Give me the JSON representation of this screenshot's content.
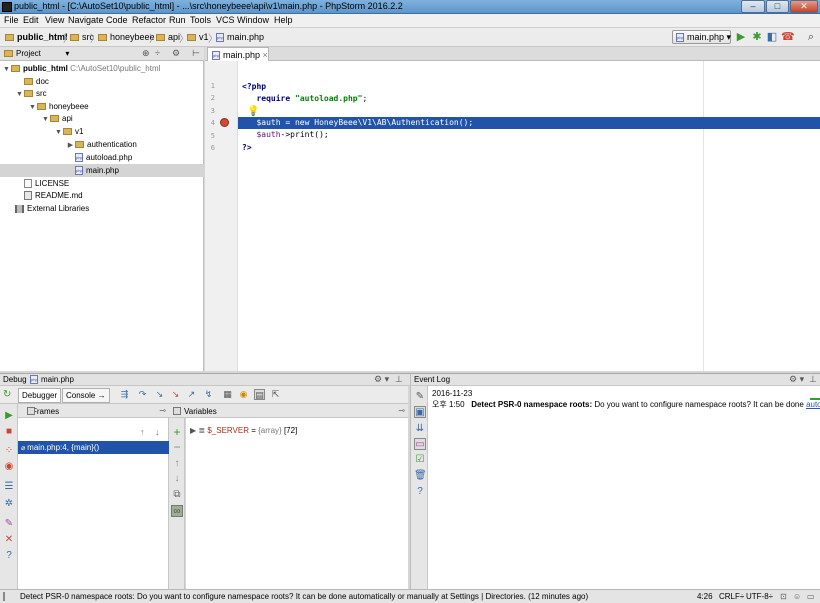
{
  "window": {
    "title": "public_html - [C:\\AutoSet10\\public_html] - ...\\src\\honeybeee\\api\\v1\\main.php - PhpStorm 2016.2.2"
  },
  "menu": [
    "File",
    "Edit",
    "View",
    "Navigate",
    "Code",
    "Refactor",
    "Run",
    "Tools",
    "VCS",
    "Window",
    "Help"
  ],
  "breadcrumbs": [
    "public_html",
    "src",
    "honeybeee",
    "api",
    "v1",
    "main.php"
  ],
  "run_config": "main.php",
  "project": {
    "header": "Project",
    "tree": [
      {
        "label": "public_html",
        "extra": "C:\\AutoSet10\\public_html",
        "type": "folder",
        "arrow": "▼"
      },
      {
        "label": "doc",
        "type": "folder",
        "arrow": ""
      },
      {
        "label": "src",
        "type": "folder",
        "arrow": "▼"
      },
      {
        "label": "honeybeee",
        "type": "folder",
        "arrow": "▼"
      },
      {
        "label": "api",
        "type": "folder",
        "arrow": "▼"
      },
      {
        "label": "v1",
        "type": "folder",
        "arrow": "▼"
      },
      {
        "label": "authentication",
        "type": "folder",
        "arrow": "▶"
      },
      {
        "label": "autoload.php",
        "type": "php",
        "arrow": ""
      },
      {
        "label": "main.php",
        "type": "php",
        "arrow": "",
        "selected": true
      },
      {
        "label": "LICENSE",
        "type": "file",
        "arrow": ""
      },
      {
        "label": "README.md",
        "type": "md",
        "arrow": ""
      },
      {
        "label": "External Libraries",
        "type": "lib",
        "arrow": ""
      }
    ]
  },
  "editor": {
    "tab": "main.php",
    "line_numbers": [
      "1",
      "2",
      "3",
      "4",
      "5",
      "6"
    ],
    "lines": {
      "l1": "<?php",
      "l2_kw": "require",
      "l2_str": "\"autoload.php\"",
      "l2_end": ";",
      "l4": "$auth = new HoneyBeee\\V1\\AB\\Authentication();",
      "l5_var": "$auth",
      "l5_rest": "->print();",
      "l6": "?>"
    }
  },
  "debug": {
    "title": "Debug",
    "file": "main.php",
    "tabs": [
      "Debugger",
      "Console"
    ],
    "frames_header": "Frames",
    "frame_selected": "main.php:4, {main}()",
    "variables_header": "Variables",
    "variable": {
      "name": "$_SERVER",
      "eq": "=",
      "type": "{array}",
      "count": "[72]"
    }
  },
  "event_log": {
    "title": "Event Log",
    "date": "2016-11-23",
    "time": "오후 1:50",
    "message_bold": "Detect PSR-0 namespace roots:",
    "message": "Do you want to configure namespace roots? It can be done",
    "link": "autom"
  },
  "status": {
    "message": "Detect PSR-0 namespace roots: Do you want to configure namespace roots? It can be done automatically or manually at Settings | Directories. (12 minutes ago)",
    "position": "4:26",
    "line_sep": "CRLF÷",
    "encoding": "UTF-8÷"
  }
}
